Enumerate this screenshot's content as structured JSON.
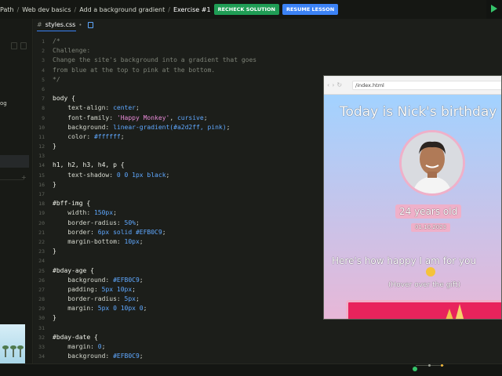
{
  "breadcrumb": {
    "items": [
      "Path",
      "Web dev basics",
      "Add a background gradient"
    ],
    "current": "Exercise #1"
  },
  "toolbar": {
    "recheck_label": "RECHECK SOLUTION",
    "resume_label": "RESUME LESSON"
  },
  "sidebar": {
    "partial_label": "og"
  },
  "editor": {
    "tab_name": "styles.css",
    "tab_modified_marker": "•",
    "lines": [
      {
        "n": "1",
        "parts": [
          [
            "cm",
            "/*"
          ]
        ]
      },
      {
        "n": "2",
        "parts": [
          [
            "cm",
            "Challenge:"
          ]
        ]
      },
      {
        "n": "3",
        "parts": [
          [
            "cm",
            "Change the site's background into a gradient that goes"
          ]
        ]
      },
      {
        "n": "4",
        "parts": [
          [
            "cm",
            "from blue at the top to pink at the bottom."
          ]
        ]
      },
      {
        "n": "5",
        "parts": [
          [
            "cm",
            "*/"
          ]
        ]
      },
      {
        "n": "6",
        "parts": []
      },
      {
        "n": "7",
        "parts": [
          [
            "sel",
            "body {"
          ]
        ]
      },
      {
        "n": "8",
        "parts": [
          [
            "prop",
            "    text-align: "
          ],
          [
            "val",
            "center"
          ],
          [
            "prop",
            ";"
          ]
        ]
      },
      {
        "n": "9",
        "parts": [
          [
            "prop",
            "    font-family: "
          ],
          [
            "str",
            "'Happy Monkey'"
          ],
          [
            "prop",
            ", "
          ],
          [
            "val",
            "cursive"
          ],
          [
            "prop",
            ";"
          ]
        ]
      },
      {
        "n": "10",
        "parts": [
          [
            "prop",
            "    background: "
          ],
          [
            "val",
            "linear-gradient(#a2d2ff, pink)"
          ],
          [
            "prop",
            ";"
          ]
        ]
      },
      {
        "n": "11",
        "parts": [
          [
            "prop",
            "    color: "
          ],
          [
            "val",
            "#ffffff"
          ],
          [
            "prop",
            ";"
          ]
        ]
      },
      {
        "n": "12",
        "parts": [
          [
            "sel",
            "}"
          ]
        ]
      },
      {
        "n": "13",
        "parts": []
      },
      {
        "n": "14",
        "parts": [
          [
            "sel",
            "h1, h2, h3, h4, p {"
          ]
        ]
      },
      {
        "n": "15",
        "parts": [
          [
            "prop",
            "    text-shadow: "
          ],
          [
            "num",
            "0 0 1px black"
          ],
          [
            "prop",
            ";"
          ]
        ]
      },
      {
        "n": "16",
        "parts": [
          [
            "sel",
            "}"
          ]
        ]
      },
      {
        "n": "17",
        "parts": []
      },
      {
        "n": "18",
        "parts": [
          [
            "sel",
            "#bff-img {"
          ]
        ]
      },
      {
        "n": "19",
        "parts": [
          [
            "prop",
            "    width: "
          ],
          [
            "num",
            "150px"
          ],
          [
            "prop",
            ";"
          ]
        ]
      },
      {
        "n": "20",
        "parts": [
          [
            "prop",
            "    border-radius: "
          ],
          [
            "num",
            "50%"
          ],
          [
            "prop",
            ";"
          ]
        ]
      },
      {
        "n": "21",
        "parts": [
          [
            "prop",
            "    border: "
          ],
          [
            "num",
            "6px solid #EFB0C9"
          ],
          [
            "prop",
            ";"
          ]
        ]
      },
      {
        "n": "22",
        "parts": [
          [
            "prop",
            "    margin-bottom: "
          ],
          [
            "num",
            "10px"
          ],
          [
            "prop",
            ";"
          ]
        ]
      },
      {
        "n": "23",
        "parts": [
          [
            "sel",
            "}"
          ]
        ]
      },
      {
        "n": "24",
        "parts": []
      },
      {
        "n": "25",
        "parts": [
          [
            "sel",
            "#bday-age {"
          ]
        ]
      },
      {
        "n": "26",
        "parts": [
          [
            "prop",
            "    background: "
          ],
          [
            "val",
            "#EFB0C9"
          ],
          [
            "prop",
            ";"
          ]
        ]
      },
      {
        "n": "27",
        "parts": [
          [
            "prop",
            "    padding: "
          ],
          [
            "num",
            "5px 10px"
          ],
          [
            "prop",
            ";"
          ]
        ]
      },
      {
        "n": "28",
        "parts": [
          [
            "prop",
            "    border-radius: "
          ],
          [
            "num",
            "5px"
          ],
          [
            "prop",
            ";"
          ]
        ]
      },
      {
        "n": "29",
        "parts": [
          [
            "prop",
            "    margin: "
          ],
          [
            "num",
            "5px 0 10px 0"
          ],
          [
            "prop",
            ";"
          ]
        ]
      },
      {
        "n": "30",
        "parts": [
          [
            "sel",
            "}"
          ]
        ]
      },
      {
        "n": "31",
        "parts": []
      },
      {
        "n": "32",
        "parts": [
          [
            "sel",
            "#bday-date {"
          ]
        ]
      },
      {
        "n": "33",
        "parts": [
          [
            "prop",
            "    margin: "
          ],
          [
            "num",
            "0"
          ],
          [
            "prop",
            ";"
          ]
        ]
      },
      {
        "n": "34",
        "parts": [
          [
            "prop",
            "    background: "
          ],
          [
            "val",
            "#EFB0C9"
          ],
          [
            "prop",
            ";"
          ]
        ]
      }
    ]
  },
  "preview": {
    "url": "/index.html",
    "title": "Today is Nick's birthday",
    "age": "24 years old",
    "date": "01.10.2023",
    "happy_text": "Here's how happy I am for you",
    "hover_text": "(Hover over the gift)"
  },
  "colors": {
    "recheck": "#1f9d55",
    "resume": "#3b82f6",
    "accent_pink": "#EFB0C9",
    "gradient_top": "#a2d2ff"
  }
}
